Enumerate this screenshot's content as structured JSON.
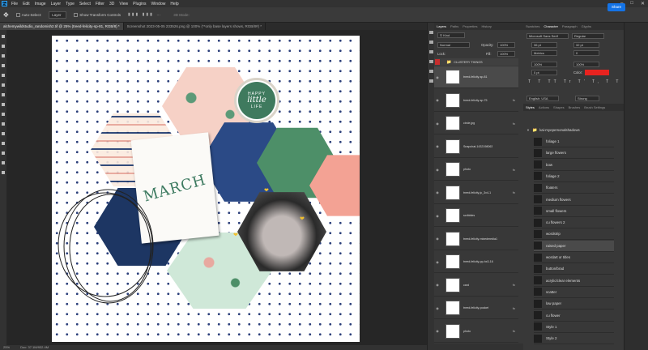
{
  "app": {
    "logo": "Ps"
  },
  "menu": [
    "File",
    "Edit",
    "Image",
    "Layer",
    "Type",
    "Select",
    "Filter",
    "3D",
    "View",
    "Plugins",
    "Window",
    "Help"
  ],
  "options": {
    "auto_select": "Auto-Select:",
    "layer": "Layer",
    "show_transform": "Show Transform Controls",
    "mode3d": "3D Mode:",
    "share": "Share"
  },
  "tabs": [
    "alchemywildstudio_randomish2.tif @ 25% (treed-felicity-sp-81, RGB/8) *",
    "Screenshot 2023-05-05 233526.png @ 100% (**only base layers shows, RGB/8#) *"
  ],
  "status": {
    "zoom": "25%",
    "doc": "Doc: 37.1M/932.4M"
  },
  "canvas": {
    "badge_line1": "HAPPY",
    "badge_line2": "little",
    "badge_line3": "LIFE",
    "card_title": "MARCH"
  },
  "layers_panel": {
    "tabs": [
      "Layers",
      "Paths",
      "Properties",
      "History"
    ],
    "kind": "Kind",
    "blend": "Normal",
    "opacity_label": "Opacity:",
    "opacity": "100%",
    "lock_label": "Lock:",
    "fill_label": "Fill:",
    "fill": "100%",
    "group": "CLUSTERY THINGS",
    "layers": [
      {
        "name": "treed-felicity-sp-81",
        "fx": false
      },
      {
        "name": "treed-felicity-sp-75",
        "fx": true
      },
      {
        "name": "circle.jpg",
        "fx": true
      },
      {
        "name": "Snapchat-1432198063",
        "fx": false
      },
      {
        "name": "photo",
        "fx": true
      },
      {
        "name": "treed-felicity-jc_3x4-1",
        "fx": true
      },
      {
        "name": "scribbles",
        "fx": false
      },
      {
        "name": "treed-felicity-mixedmedia1",
        "fx": false
      },
      {
        "name": "treed-felicity-pp-hx3-16",
        "fx": false
      },
      {
        "name": "card",
        "fx": true
      },
      {
        "name": "treed-felicity-pocket",
        "fx": true
      },
      {
        "name": "photo",
        "fx": true
      }
    ]
  },
  "char_panel": {
    "tabs": [
      "Swatches",
      "Character",
      "Paragraph",
      "Glyphs"
    ],
    "font": "Microsoft Sans Serif",
    "style": "Regular",
    "size": "36 pt",
    "leading": "32 pt",
    "kerning": "Metrics",
    "tracking": "0",
    "scale_v": "100%",
    "scale_h": "100%",
    "baseline": "0 pt",
    "color_label": "Color:",
    "color": "#e8231f",
    "language": "English: USA",
    "aa": "Strong"
  },
  "styles_panel": {
    "tabs": [
      "Styles",
      "Actions",
      "Shapes",
      "Brushes",
      "Brush Settings"
    ],
    "group": "kai-myepersonalshadows",
    "items": [
      "foliage 1",
      "large flowers",
      "bow",
      "foliage 2",
      "floaters",
      "medium flowers",
      "small flowers",
      "cu flowers 2",
      "wordstrip",
      "raised paper",
      "wordart or titles",
      "button/brad",
      "acrylic/clear elements",
      "scatter",
      "low paper",
      "cu flower",
      "Style 1",
      "Style 2"
    ],
    "selected": "raised paper"
  }
}
